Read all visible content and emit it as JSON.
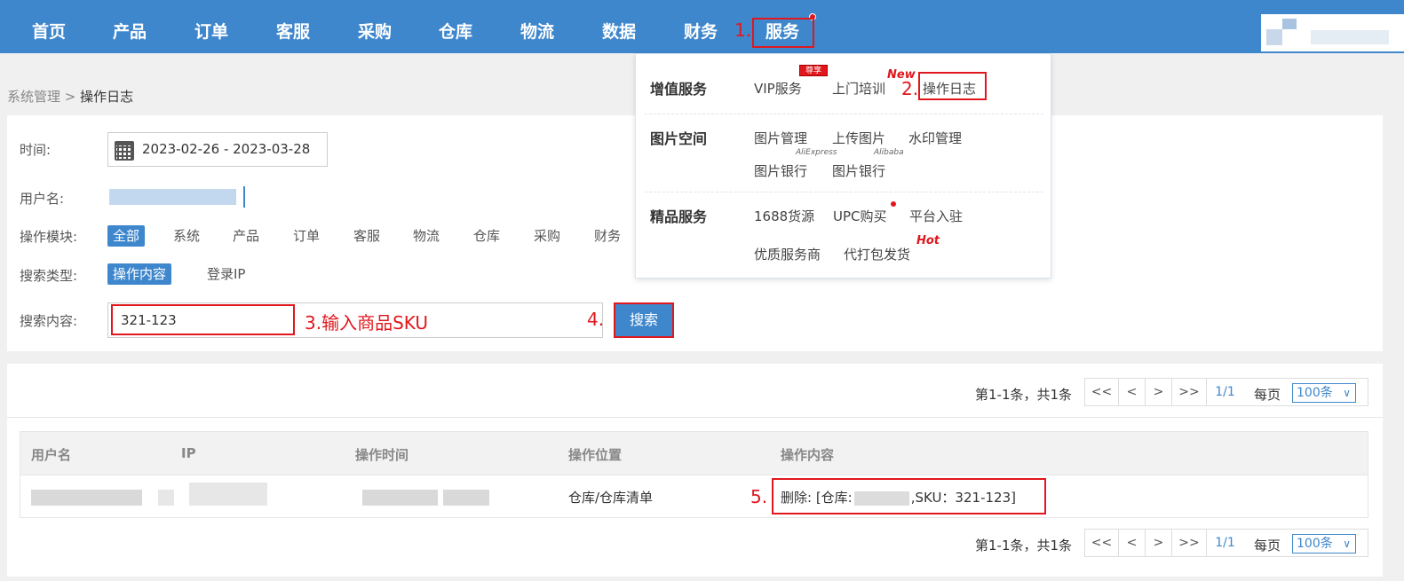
{
  "nav": {
    "items": [
      "首页",
      "产品",
      "订单",
      "客服",
      "采购",
      "仓库",
      "物流",
      "数据",
      "财务",
      "服务"
    ]
  },
  "annotations": {
    "step1": "1.",
    "step2": "2.",
    "step3": "3.输入商品SKU",
    "step4": "4.",
    "step5": "5."
  },
  "breadcrumb": {
    "parent": "系统管理",
    "separator": ">",
    "current": "操作日志"
  },
  "filters": {
    "time_label": "时间:",
    "date_range": "2023-02-26 - 2023-03-28",
    "username_label": "用户名:",
    "module_label": "操作模块:",
    "modules": [
      "全部",
      "系统",
      "产品",
      "订单",
      "客服",
      "物流",
      "仓库",
      "采购",
      "财务"
    ],
    "search_type_label": "搜索类型:",
    "search_types": [
      "操作内容",
      "登录IP"
    ],
    "search_content_label": "搜索内容:",
    "search_value": "321-123",
    "search_button": "搜索"
  },
  "dropdown": {
    "sections": [
      {
        "title": "增值服务",
        "links": [
          "VIP服务",
          "上门培训",
          "操作日志"
        ]
      },
      {
        "title": "图片空间",
        "links": [
          "图片管理",
          "上传图片",
          "水印管理",
          "图片银行",
          "图片银行"
        ]
      },
      {
        "title": "精品服务",
        "links": [
          "1688货源",
          "UPC购买",
          "平台入驻",
          "优质服务商",
          "代打包发货"
        ]
      }
    ],
    "badge_vip": "尊享",
    "tag_new": "New",
    "tag_aliexpress": "AliExpress",
    "tag_alibaba": "Alibaba",
    "tag_hot": "Hot"
  },
  "pager": {
    "info": "第1-1条，共1条",
    "first": "<<",
    "prev": "<",
    "next": ">",
    "last": ">>",
    "page": "1/1",
    "per_page_label": "每页",
    "per_page_value": "100条"
  },
  "table": {
    "columns": [
      "用户名",
      "IP",
      "操作时间",
      "操作位置",
      "操作内容"
    ],
    "rows": [
      {
        "location": "仓库/仓库清单",
        "content_prefix": "删除: [仓库:",
        "content_suffix": ",SKU：321-123]"
      }
    ]
  },
  "colors": {
    "primary": "#3f87cc",
    "annotation": "#e0181e"
  }
}
